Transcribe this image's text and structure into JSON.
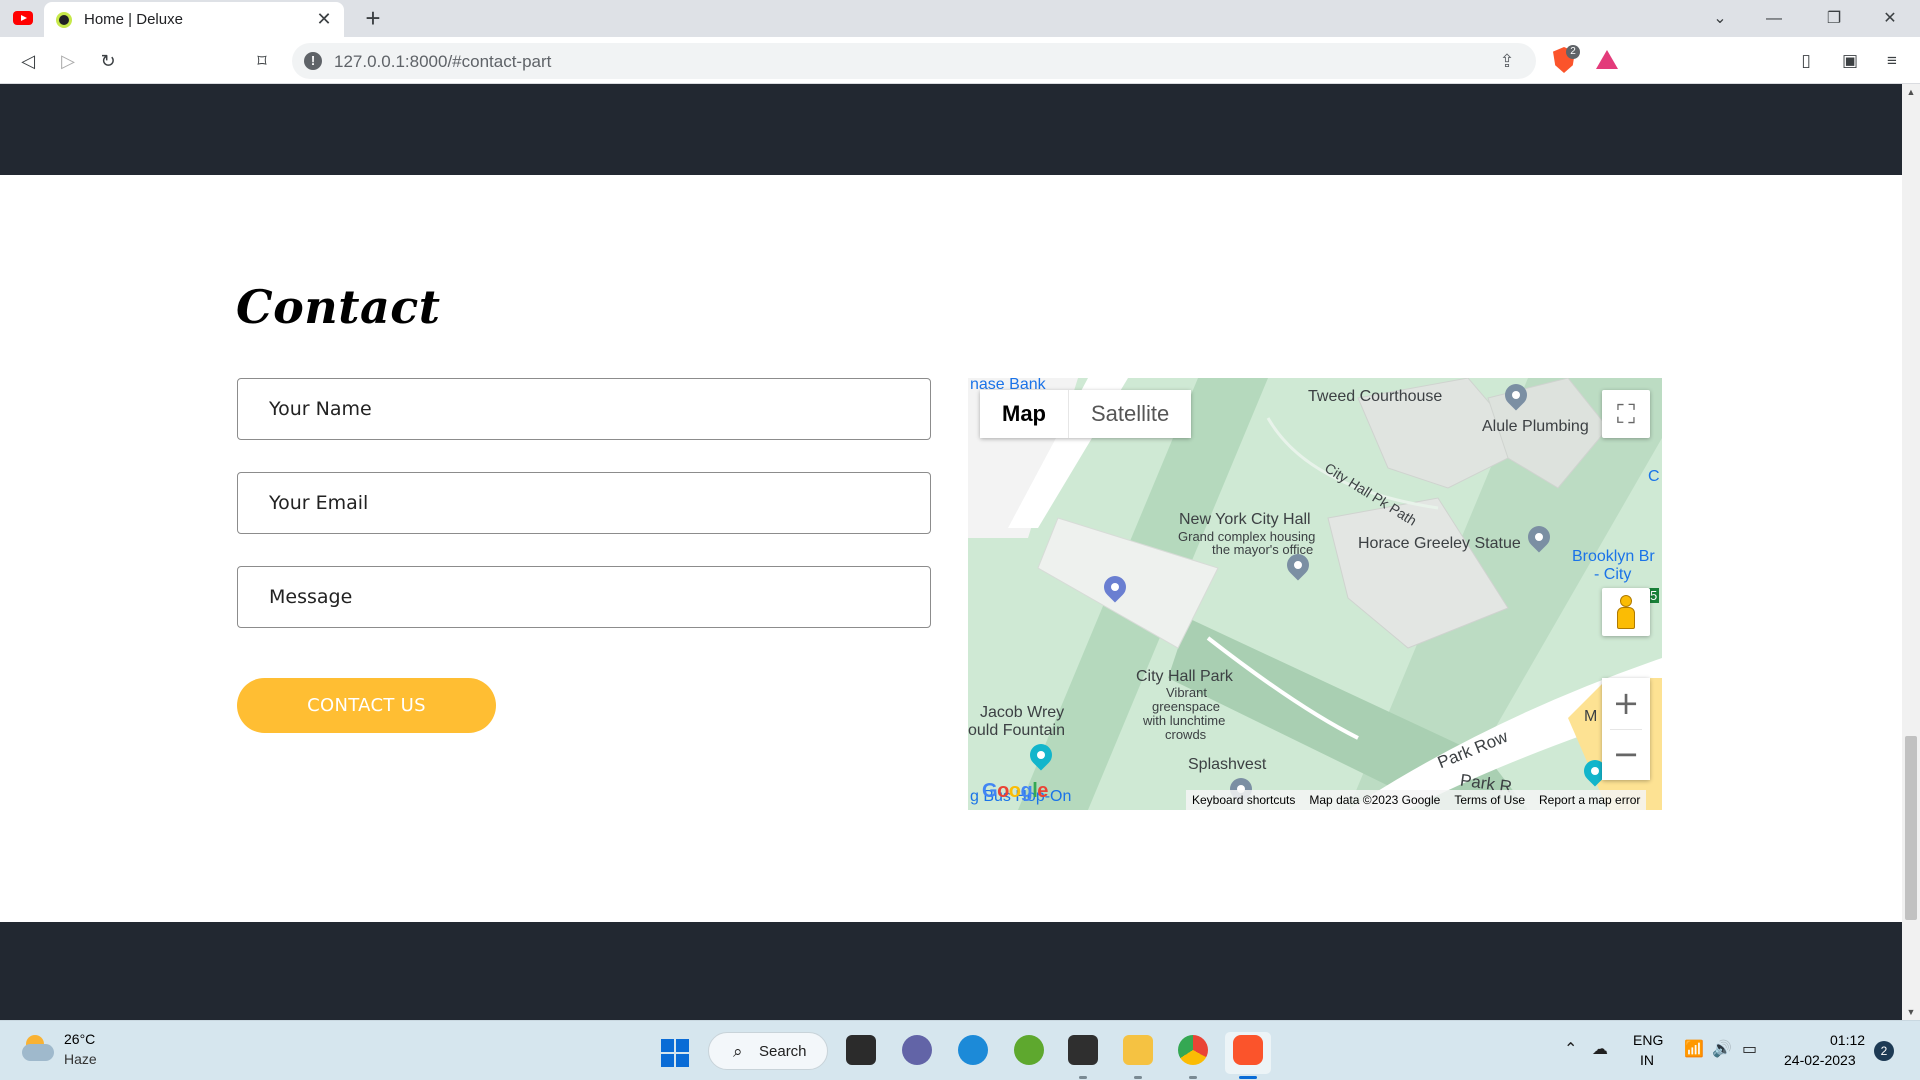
{
  "browser": {
    "tab_title": "Home | Deluxe",
    "tab_close": "✕",
    "new_tab": "+",
    "url": "127.0.0.1:8000/#contact-part",
    "brave_badge": "2",
    "window_controls": {
      "dropdown": "⌄",
      "minimize": "—",
      "restore": "❐",
      "close": "✕"
    }
  },
  "contact": {
    "heading": "Contact",
    "name_placeholder": "Your Name",
    "email_placeholder": "Your Email",
    "message_placeholder": "Message",
    "button_label": "CONTACT US",
    "accent_color": "#ffbe33"
  },
  "map": {
    "type_map": "Map",
    "type_satellite": "Satellite",
    "labels": {
      "chase_bank": "nase Bank",
      "tweed_courthouse": "Tweed Courthouse",
      "alule_plumbing": "Alule Plumbing",
      "city_hall_pk_path": "City Hall Pk Path",
      "nyc_hall": "New York City Hall",
      "nyc_hall_desc1": "Grand complex housing",
      "nyc_hall_desc2": "the mayor's office",
      "horace_greeley": "Horace Greeley Statue",
      "brooklyn_br1": "Brooklyn Br",
      "brooklyn_br2": "- City",
      "city_hall_park": "City Hall Park",
      "chp_desc1": "Vibrant",
      "chp_desc2": "greenspace",
      "chp_desc3": "with lunchtime",
      "chp_desc4": "crowds",
      "jacob_wrey1": "Jacob Wrey",
      "jacob_wrey2": "ould Fountain",
      "splashvest": "Splashvest",
      "park_row": "Park Row",
      "park_row2": "Park R",
      "bus_stop": "g Bus Hop-On",
      "edge_m": "M",
      "edge_c": "C",
      "edge_5": "5"
    },
    "google": "Google",
    "footer": [
      "Keyboard shortcuts",
      "Map data ©2023 Google",
      "Terms of Use",
      "Report a map error"
    ],
    "zoom_in": "+",
    "zoom_out": "−"
  },
  "taskbar": {
    "temperature": "26°C",
    "weather": "Haze",
    "search_label": "Search",
    "lang_line1": "ENG",
    "lang_line2": "IN",
    "time": "01:12",
    "date": "24-02-2023",
    "notifications": "2"
  }
}
